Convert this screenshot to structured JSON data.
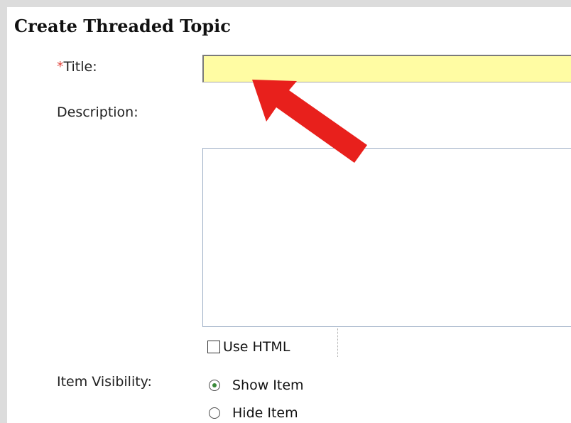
{
  "form": {
    "heading": "Create Threaded Topic"
  },
  "fields": {
    "title": {
      "required_marker": "*",
      "label": "Title:",
      "value": ""
    },
    "description": {
      "label": "Description:",
      "value": ""
    },
    "use_html": {
      "label": "Use HTML",
      "checked": false
    },
    "visibility": {
      "label": "Item Visibility:",
      "options": [
        {
          "label": "Show Item",
          "selected": true
        },
        {
          "label": "Hide Item",
          "selected": false
        }
      ]
    }
  },
  "colors": {
    "title_input_bg": "#fffca3",
    "required_marker": "#e0423a",
    "annotation_arrow": "#e8201c",
    "radio_dot": "#3a8a3a"
  },
  "icons": {
    "annotation": "arrow-pointer-icon"
  }
}
